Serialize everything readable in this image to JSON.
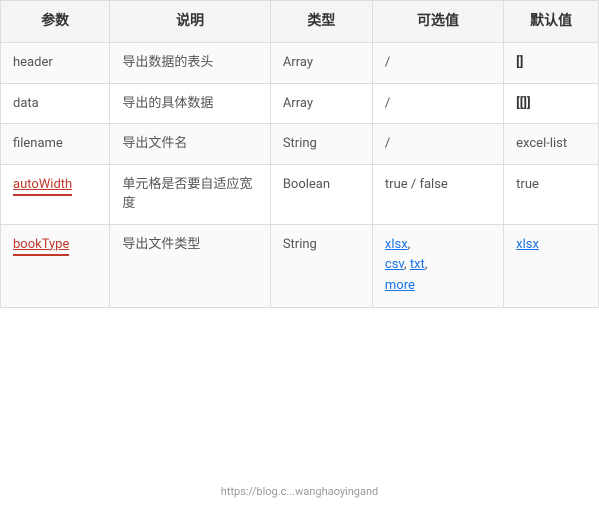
{
  "table": {
    "headers": [
      "参数",
      "说明",
      "类型",
      "可选值",
      "默认值"
    ],
    "rows": [
      {
        "param": "header",
        "param_link": false,
        "description": "导出数据的表头",
        "type": "Array",
        "options": "/",
        "default": "[]",
        "default_bold": true
      },
      {
        "param": "data",
        "param_link": false,
        "description": "导出的具体数据",
        "type": "Array",
        "options": "/",
        "default": "[[]]",
        "default_bold": true
      },
      {
        "param": "filename",
        "param_link": false,
        "description": "导出文件名",
        "type": "String",
        "options": "/",
        "default": "excel-list",
        "default_bold": false
      },
      {
        "param": "autoWidth",
        "param_link": true,
        "description": "单元格是否要自适应宽度",
        "type": "Boolean",
        "options": "true / false",
        "default": "true",
        "default_bold": false
      },
      {
        "param": "bookType",
        "param_link": true,
        "description": "导出文件类型",
        "type": "String",
        "options_list": [
          "xlsx,",
          "csv, txt,",
          "more"
        ],
        "options_has_link": true,
        "default": "xlsx",
        "default_bold": false,
        "default_link": true
      }
    ]
  },
  "watermark": "https://blog.c...wanghaoyingand"
}
